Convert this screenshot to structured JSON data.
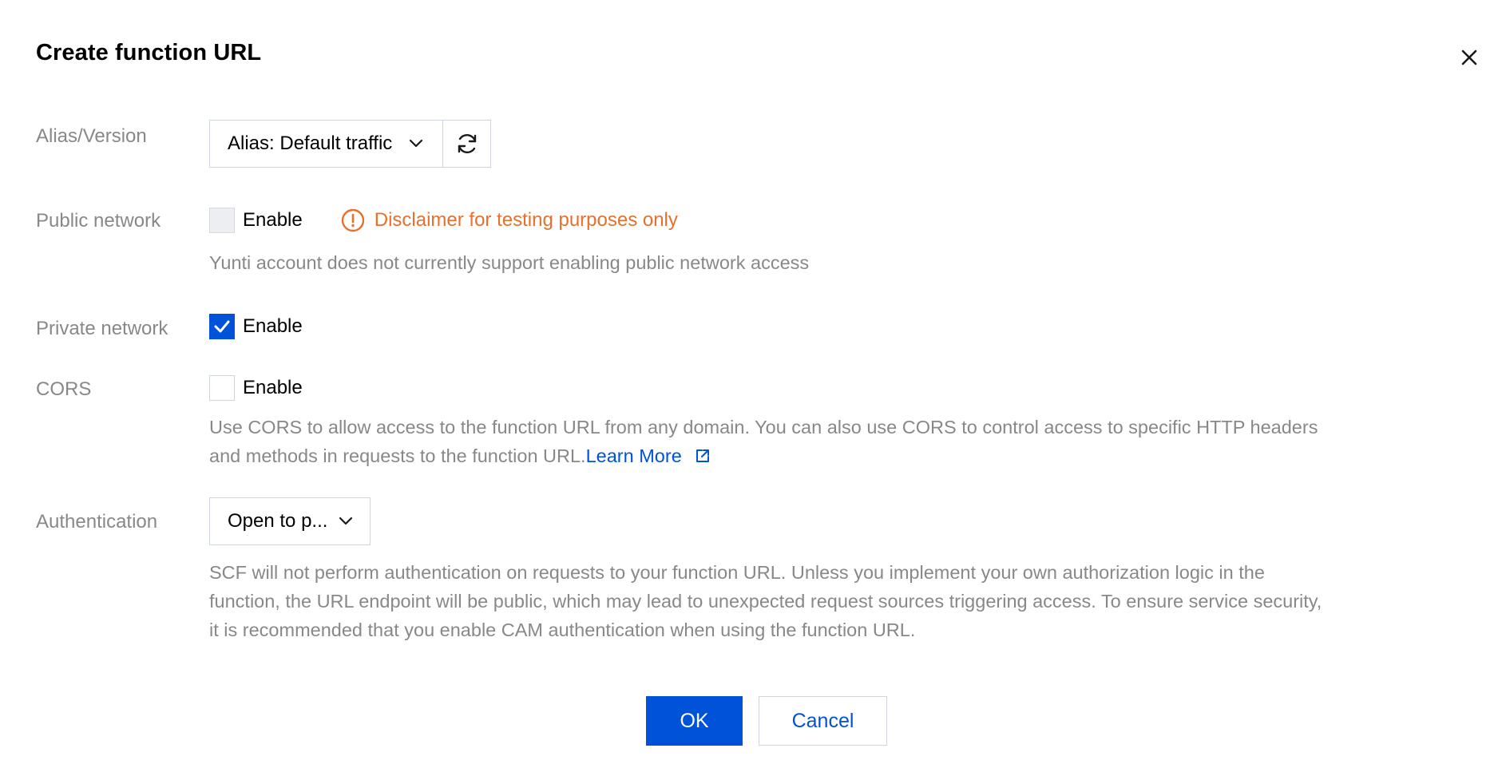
{
  "dialog": {
    "title": "Create function URL",
    "close_icon": "close-icon"
  },
  "alias_version": {
    "label": "Alias/Version",
    "selected": "Alias: Default traffic",
    "refresh_icon": "refresh-icon"
  },
  "public_network": {
    "label": "Public network",
    "checkbox_label": "Enable",
    "checked": false,
    "disabled": true,
    "warning_icon": "exclamation-circle-icon",
    "warning_text": "Disclaimer for testing purposes only",
    "help_text": "Yunti account does not currently support enabling public network access"
  },
  "private_network": {
    "label": "Private network",
    "checkbox_label": "Enable",
    "checked": true
  },
  "cors": {
    "label": "CORS",
    "checkbox_label": "Enable",
    "checked": false,
    "help_line1": "Use CORS to allow access to the function URL from any domain. You can also use CORS to control access to specific HTTP headers",
    "help_line2": "and methods in requests to the function URL.",
    "learn_more": "Learn More",
    "external_icon": "external-link-icon"
  },
  "authentication": {
    "label": "Authentication",
    "selected": "Open to p...",
    "help_line1": "SCF will not perform authentication on requests to your function URL. Unless you implement your own authorization logic in the",
    "help_line2": "function, the URL endpoint will be public, which may lead to unexpected request sources triggering access. To ensure service security,",
    "help_line3": "it is recommended that you enable CAM authentication when using the function URL."
  },
  "footer": {
    "ok_label": "OK",
    "cancel_label": "Cancel"
  },
  "colors": {
    "primary": "#0052d9",
    "warning": "#e8702a",
    "label_gray": "#888888",
    "border": "#cfd5de"
  }
}
